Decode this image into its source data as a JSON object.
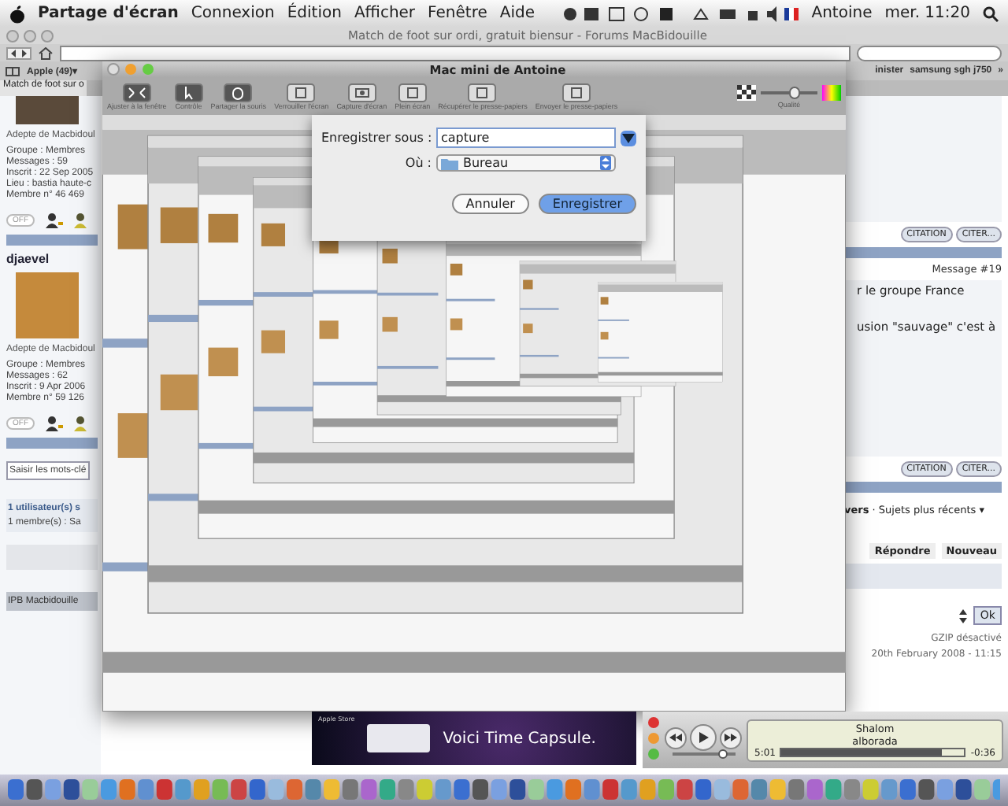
{
  "menu_bar": {
    "app": "Partage d'écran",
    "menus": [
      "Connexion",
      "Édition",
      "Afficher",
      "Fenêtre",
      "Aide"
    ],
    "user": "Antoine",
    "clock": "mer. 11:20"
  },
  "browser": {
    "title": "Match de foot sur ordi, gratuit biensur - Forums MacBidouille",
    "bookmarks": [
      "Apple (49)▾"
    ],
    "right_bookmarks": [
      "inister",
      "samsung sgh j750",
      "»"
    ],
    "tab": "Match de foot sur o"
  },
  "forum": {
    "posts": [
      {
        "role": "Adepte de Macbidoul",
        "details": [
          "Groupe : Membres",
          "Messages : 59",
          "Inscrit : 22 Sep 2005",
          "Lieu : bastia haute-c",
          "Membre n° 46 469"
        ],
        "status": "OFF"
      },
      {
        "author": "djaevel",
        "role": "Adepte de Macbidoul",
        "details": [
          "Groupe : Membres",
          "Messages : 62",
          "Inscrit : 9 Apr 2006",
          "Membre n° 59 126"
        ],
        "status": "OFF"
      }
    ],
    "search": {
      "placeholder": "Saisir les mots-clé"
    },
    "online": {
      "title": "1 utilisateur(s) s",
      "members": "1 membre(s) : Sa"
    },
    "footer": "IPB Macbidouille",
    "quote_buttons": [
      "CITATION",
      "CITER..."
    ],
    "message_number": "Message #19",
    "message_lines": [
      "r le groupe France",
      "usion \"sauvage\" c'est à"
    ],
    "quote_buttons_2": [
      "CITATION",
      "CITER..."
    ],
    "nav": "**vers** · Sujets plus récents ▾",
    "actions": [
      "Répondre",
      "Nouveau"
    ],
    "go_button": "Ok",
    "gzip": "GZIP désactivé",
    "date": "20th February 2008 - 11:15"
  },
  "screen_share": {
    "title": "Mac mini de Antoine",
    "tools": [
      "Ajuster à la fenêtre",
      "Contrôle",
      "Partager la souris",
      "Verrouiller l'écran",
      "Capture d'écran",
      "Plein écran",
      "Récupérer le presse-papiers",
      "Envoyer le presse-papiers"
    ],
    "quality": {
      "label": "Qualité",
      "level": 0.6
    }
  },
  "save_sheet": {
    "save_as_label": "Enregistrer sous :",
    "save_as_value": "capture",
    "where_label": "Où :",
    "where_value": "Bureau",
    "buttons": [
      {
        "label": "Annuler",
        "default": false
      },
      {
        "label": "Enregistrer",
        "default": true
      }
    ]
  },
  "ad": {
    "store": "Apple Store",
    "headline": "Voici Time Capsule."
  },
  "player": {
    "track": "Shalom",
    "artist": "alborada",
    "elapsed": "5:01",
    "remaining": "-0:36",
    "progress": {
      "level": 0.88
    },
    "volume": {
      "level": 0.8
    }
  }
}
